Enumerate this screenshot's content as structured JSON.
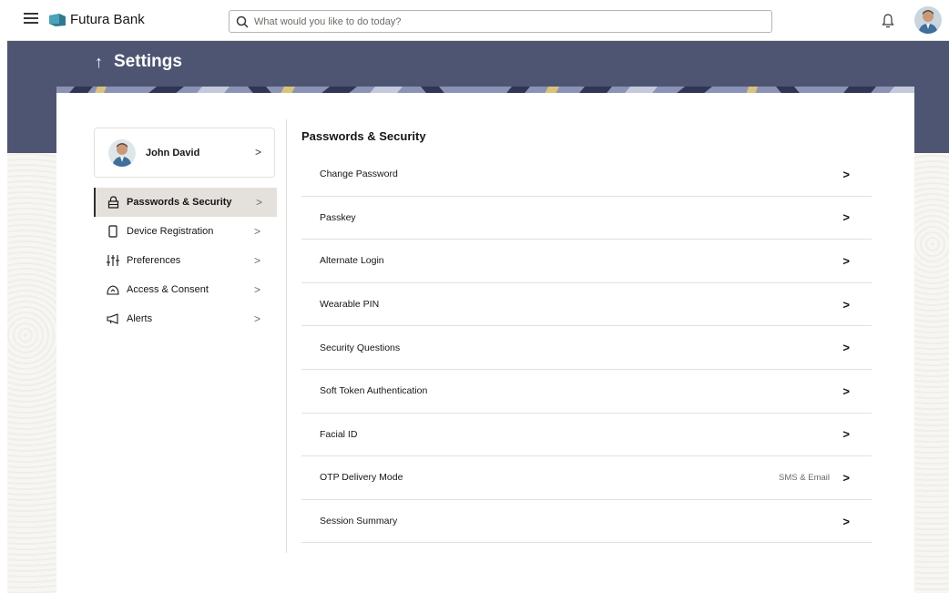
{
  "header": {
    "brand": "Futura Bank",
    "search_placeholder": "What would you like to do today?"
  },
  "page": {
    "title": "Settings"
  },
  "profile": {
    "name": "John David"
  },
  "sidebar": {
    "items": [
      {
        "label": "Passwords & Security",
        "icon": "lock-icon",
        "active": true
      },
      {
        "label": "Device Registration",
        "icon": "mobile-icon",
        "active": false
      },
      {
        "label": "Preferences",
        "icon": "sliders-icon",
        "active": false
      },
      {
        "label": "Access & Consent",
        "icon": "consent-icon",
        "active": false
      },
      {
        "label": "Alerts",
        "icon": "megaphone-icon",
        "active": false
      }
    ]
  },
  "main": {
    "section_title": "Passwords & Security",
    "items": [
      {
        "label": "Change Password",
        "value": ""
      },
      {
        "label": "Passkey",
        "value": ""
      },
      {
        "label": "Alternate Login",
        "value": ""
      },
      {
        "label": "Wearable PIN",
        "value": ""
      },
      {
        "label": "Security Questions",
        "value": ""
      },
      {
        "label": "Soft Token Authentication",
        "value": ""
      },
      {
        "label": "Facial ID",
        "value": ""
      },
      {
        "label": "OTP Delivery Mode",
        "value": "SMS & Email"
      },
      {
        "label": "Session Summary",
        "value": ""
      }
    ]
  },
  "colors": {
    "banner": "#4e5572",
    "active_bg": "#e4e1dc",
    "brand_logo": "#2f7a8f"
  }
}
